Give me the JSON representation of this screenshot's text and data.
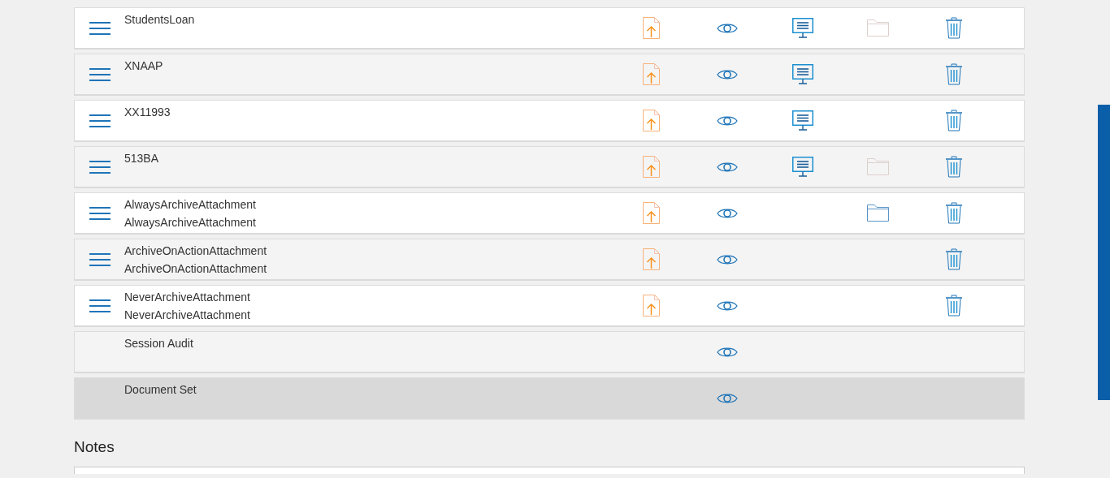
{
  "rows": [
    {
      "kind": "document",
      "name": "StudentsLoan",
      "actions": [
        {
          "kind": "upload"
        },
        {
          "kind": "view"
        },
        {
          "kind": "display"
        },
        {
          "kind": "folder",
          "disabled": true
        },
        {
          "kind": "delete"
        }
      ],
      "selected": false
    },
    {
      "kind": "document",
      "name": "XNAAP",
      "actions": [
        {
          "kind": "upload"
        },
        {
          "kind": "view"
        },
        {
          "kind": "display"
        },
        {
          "kind": "delete"
        }
      ],
      "selected": false
    },
    {
      "kind": "document",
      "name": "XX11993",
      "actions": [
        {
          "kind": "upload"
        },
        {
          "kind": "view"
        },
        {
          "kind": "display"
        },
        {
          "kind": "delete"
        }
      ],
      "selected": false
    },
    {
      "kind": "document",
      "name": "513BA",
      "actions": [
        {
          "kind": "upload"
        },
        {
          "kind": "view"
        },
        {
          "kind": "display"
        },
        {
          "kind": "folder",
          "disabled": true
        },
        {
          "kind": "delete"
        }
      ],
      "selected": false
    },
    {
      "kind": "document",
      "name": "AlwaysArchiveAttachment",
      "subtitle": "AlwaysArchiveAttachment",
      "actions": [
        {
          "kind": "upload"
        },
        {
          "kind": "view"
        },
        {
          "kind": "folder",
          "disabled": false
        },
        {
          "kind": "delete"
        }
      ],
      "selected": false
    },
    {
      "kind": "document",
      "name": "ArchiveOnActionAttachment",
      "subtitle": "ArchiveOnActionAttachment",
      "actions": [
        {
          "kind": "upload"
        },
        {
          "kind": "view"
        },
        {
          "kind": "delete"
        }
      ],
      "selected": false
    },
    {
      "kind": "document",
      "name": "NeverArchiveAttachment",
      "subtitle": "NeverArchiveAttachment",
      "actions": [
        {
          "kind": "upload"
        },
        {
          "kind": "view"
        },
        {
          "kind": "delete"
        }
      ],
      "selected": false
    },
    {
      "kind": "system",
      "name": "Session Audit",
      "actions": [
        {
          "kind": "view"
        }
      ],
      "selected": false
    },
    {
      "kind": "system",
      "name": "Document Set",
      "actions": [
        {
          "kind": "view"
        }
      ],
      "selected": true
    }
  ],
  "notes": {
    "title": "Notes"
  }
}
